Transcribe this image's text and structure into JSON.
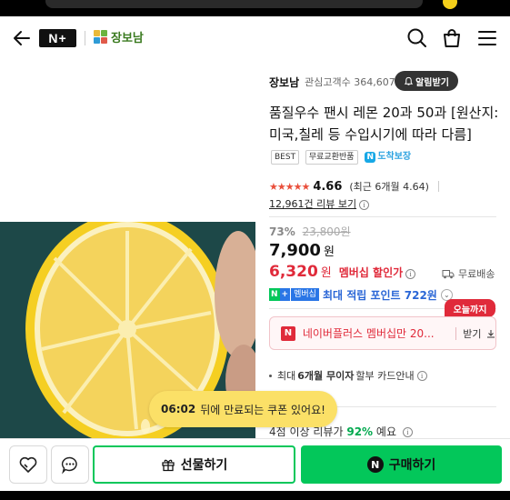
{
  "header": {
    "nplus_label": "N+",
    "shop_logo_text": "장보남"
  },
  "seller": {
    "name": "장보남",
    "followers_label": "관심고객수 364,607",
    "alarm_button": "알림받기"
  },
  "product": {
    "title": "품질우수 팬시 레몬 20과 50과 [원산지:미국,칠레 등 수입시기에 따라 다름]",
    "badges": [
      "BEST",
      "무료교환반품"
    ],
    "delivery_label": "도착보장"
  },
  "rating": {
    "stars": "★★★★★",
    "score": "4.66",
    "recent": "(최근 6개월 4.64)",
    "reviews": "12,961건 리뷰 보기"
  },
  "price": {
    "discount_pct": "73%",
    "original": "23,800원",
    "sale": "7,900",
    "won": "원",
    "member_price": "6,320",
    "member_label": "멤버십 할인가",
    "shipping": "무료배송"
  },
  "points": {
    "badge_n": "N",
    "badge_plus": "+",
    "badge_member": "멤버십",
    "text": "최대 적립 포인트 722원"
  },
  "coupon": {
    "today_tag": "오늘까지",
    "icon": "N",
    "text": "네이버플러스 멤버십만 20...",
    "get_label": "받기"
  },
  "installment": {
    "prefix": "최대",
    "bold": "6개월 무이자",
    "suffix": "할부 카드안내"
  },
  "review_percent": {
    "prefix": "4점 이상 리뷰가",
    "pct": "92%",
    "suffix": "예요"
  },
  "toast": {
    "time": "06:02",
    "message": "뒤에 만료되는 쿠폰 있어요!"
  },
  "bottom": {
    "gift_label": "선물하기",
    "buy_label": "구매하기",
    "npay_icon": "N"
  },
  "colors": {
    "brand_green": "#03c75a",
    "sale_red": "#e02a3a",
    "points_blue": "#2a66d6",
    "toast_yellow": "#fbe067"
  }
}
